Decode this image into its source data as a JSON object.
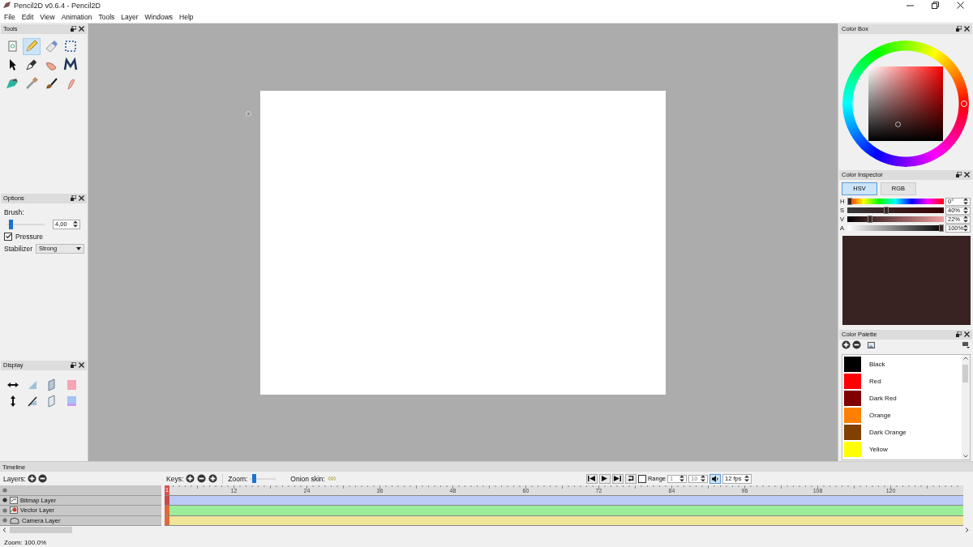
{
  "window": {
    "title": "Pencil2D v0.6.4 - Pencil2D"
  },
  "menu": [
    "File",
    "Edit",
    "View",
    "Animation",
    "Tools",
    "Layer",
    "Windows",
    "Help"
  ],
  "tools": {
    "title": "Tools",
    "items": [
      {
        "kind": "clear",
        "selected": false
      },
      {
        "kind": "pencil",
        "selected": true
      },
      {
        "kind": "eraser",
        "selected": false
      },
      {
        "kind": "select",
        "selected": false
      },
      {
        "kind": "pointer",
        "selected": false
      },
      {
        "kind": "pen",
        "selected": false
      },
      {
        "kind": "hand",
        "selected": false
      },
      {
        "kind": "polyline",
        "selected": false
      },
      {
        "kind": "bucket",
        "selected": false
      },
      {
        "kind": "eyedropper",
        "selected": false
      },
      {
        "kind": "brush",
        "selected": false
      },
      {
        "kind": "smudge",
        "selected": false
      }
    ]
  },
  "options": {
    "title": "Options",
    "brush": {
      "label": "Brush:",
      "level": 0.05,
      "value": "4,00"
    },
    "pressure": {
      "label": "Pressure",
      "checked": true
    },
    "stabilizer": {
      "label": "Stabilizer",
      "value": "Strong"
    }
  },
  "display": {
    "title": "Display",
    "items": [
      {
        "kind": "flip-horizontal"
      },
      {
        "kind": "triangle"
      },
      {
        "kind": "page"
      },
      {
        "kind": "onion-previous"
      },
      {
        "kind": "flip-vertical"
      },
      {
        "kind": "pen-line"
      },
      {
        "kind": "page-outline"
      },
      {
        "kind": "onion-next"
      }
    ]
  },
  "color_box": {
    "title": "Color Box"
  },
  "color_inspector": {
    "title": "Color Inspector",
    "tabs": [
      {
        "label": "HSV",
        "selected": true
      },
      {
        "label": "RGB",
        "selected": false
      }
    ],
    "channels": [
      {
        "name": "H",
        "level": 0,
        "reading": "0°"
      },
      {
        "name": "S",
        "level": 0.4,
        "reading": "40%"
      },
      {
        "name": "V",
        "level": 0.22,
        "reading": "22%"
      },
      {
        "name": "A",
        "level": 1,
        "reading": "100%"
      }
    ]
  },
  "color_palette": {
    "title": "Color Palette",
    "colors": [
      {
        "name": "Black",
        "color": "#000000"
      },
      {
        "name": "Red",
        "color": "#ff0000"
      },
      {
        "name": "Dark Red",
        "color": "#800000"
      },
      {
        "name": "Orange",
        "color": "#ff8000"
      },
      {
        "name": "Dark Orange",
        "color": "#804000"
      },
      {
        "name": "Yellow",
        "color": "#ffff00"
      }
    ]
  },
  "timeline": {
    "title": "Timeline",
    "layers_label": "Layers:",
    "keys_label": "Keys:",
    "zoom": {
      "label": "Zoom:",
      "level": 0.1
    },
    "onion_label": "Onion skin:",
    "range": {
      "label": "Range",
      "checked": false,
      "start": "1",
      "end": "10"
    },
    "sound": {
      "on": true
    },
    "fps": "12 fps",
    "ruler": [
      "1",
      "12",
      "24",
      "36",
      "48",
      "60",
      "72",
      "84",
      "96",
      "108",
      "120"
    ],
    "layers": [
      {
        "name": "Bitmap Layer",
        "kind": "bitmap",
        "color": "#bccaf6"
      },
      {
        "name": "Vector Layer",
        "kind": "vector",
        "color": "#9ced9a"
      },
      {
        "name": "Camera Layer",
        "kind": "camera",
        "color": "#f1e59a"
      }
    ]
  },
  "status_bar": {
    "text": "Zoom: 100.0%"
  }
}
